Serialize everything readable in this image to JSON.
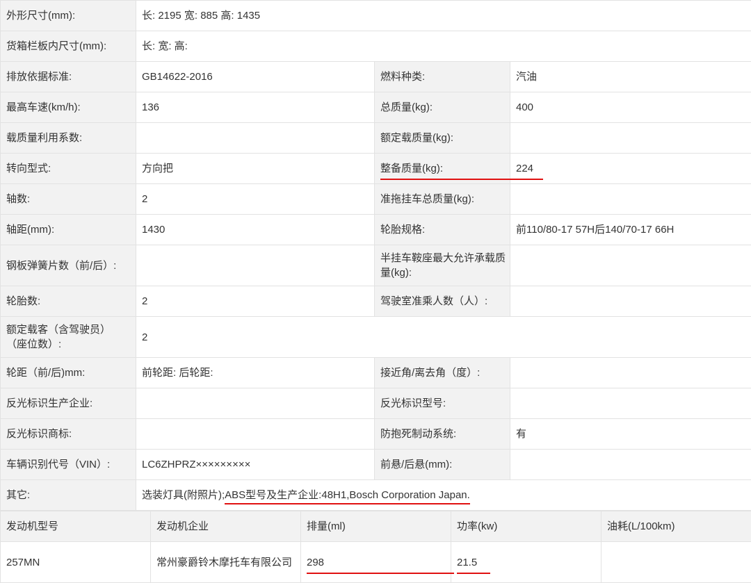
{
  "rows": [
    {
      "l1": "外形尺寸(mm):",
      "v1": "长: 2195 宽: 885 高: 1435"
    },
    {
      "l1": "货箱栏板内尺寸(mm):",
      "v1": "长:  宽:  高:"
    },
    {
      "l1": "排放依据标准:",
      "v1": "GB14622-2016",
      "l2": "燃料种类:",
      "v2": "汽油"
    },
    {
      "l1": "最高车速(km/h):",
      "v1": "136",
      "l2": "总质量(kg):",
      "v2": "400"
    },
    {
      "l1": "载质量利用系数:",
      "v1": "",
      "l2": "额定载质量(kg):",
      "v2": ""
    },
    {
      "l1": "转向型式:",
      "v1": "方向把",
      "l2": "整备质量(kg):",
      "v2": "224"
    },
    {
      "l1": "轴数:",
      "v1": "2",
      "l2": "准拖挂车总质量(kg):",
      "v2": ""
    },
    {
      "l1": "轴距(mm):",
      "v1": "1430",
      "l2": "轮胎规格:",
      "v2": "前110/80-17 57H后140/70-17 66H"
    },
    {
      "l1": "钢板弹簧片数（前/后）:",
      "v1": "",
      "l2": "半挂车鞍座最大允许承载质量(kg):",
      "v2": ""
    },
    {
      "l1": "轮胎数:",
      "v1": "2",
      "l2": "驾驶室准乘人数（人）:",
      "v2": ""
    },
    {
      "l1": "额定载客（含驾驶员）（座位数）:",
      "v1": "2"
    },
    {
      "l1": "轮距（前/后)mm:",
      "v1": "前轮距: 后轮距:",
      "l2": "接近角/离去角（度）:",
      "v2": ""
    },
    {
      "l1": "反光标识生产企业:",
      "v1": "",
      "l2": "反光标识型号:",
      "v2": ""
    },
    {
      "l1": "反光标识商标:",
      "v1": "",
      "l2": "防抱死制动系统:",
      "v2": "有"
    },
    {
      "l1": "车辆识别代号（VIN）:",
      "v1": "LC6ZHPRZ×××××××××",
      "l2": "前悬/后悬(mm):",
      "v2": ""
    },
    {
      "l1": "其它:",
      "v1a": "选装灯具(附照片);",
      "v1b": "ABS型号及生产企业:48H1,Bosch Corporation Japan."
    }
  ],
  "engine": {
    "headers": [
      "发动机型号",
      "发动机企业",
      "排量(ml)",
      "功率(kw)",
      "油耗(L/100km)"
    ],
    "row": [
      "257MN",
      "常州豪爵铃木摩托车有限公司",
      "298",
      "21.5",
      ""
    ]
  },
  "colors": {
    "label_bg": "#f2f2f2",
    "border": "#e2e2e2",
    "highlight": "#e01010"
  }
}
